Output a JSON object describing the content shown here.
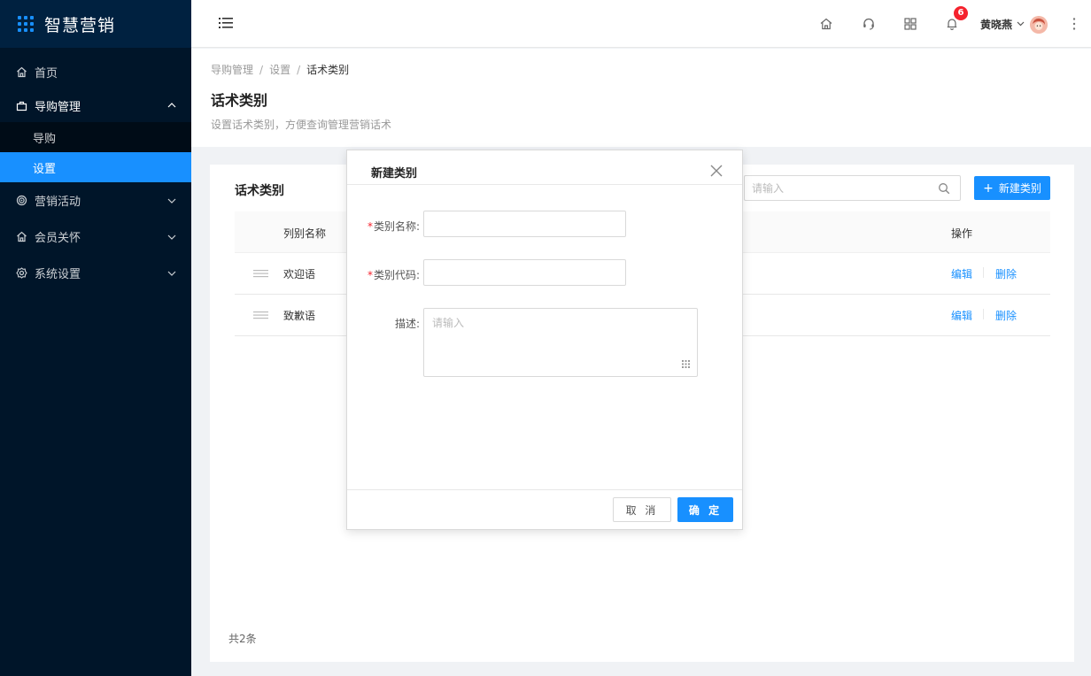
{
  "app": {
    "title": "智慧营销"
  },
  "sidebar": {
    "items": [
      {
        "label": "首页",
        "icon": "home-icon"
      },
      {
        "label": "导购管理",
        "icon": "bag-icon",
        "open": true,
        "children": [
          {
            "label": "导购"
          },
          {
            "label": "设置",
            "active": true
          }
        ]
      },
      {
        "label": "营销活动",
        "icon": "target-icon"
      },
      {
        "label": "会员关怀",
        "icon": "home-icon"
      },
      {
        "label": "系统设置",
        "icon": "gear-icon"
      }
    ]
  },
  "header": {
    "notification_count": "6",
    "user_name": "黄晓燕"
  },
  "page": {
    "breadcrumb": [
      "导购管理",
      "设置",
      "话术类别"
    ],
    "separator": "/",
    "title": "话术类别",
    "description": "设置话术类别，方便查询管理营销话术"
  },
  "card": {
    "title": "话术类别",
    "search_placeholder": "请输入",
    "new_button": "新建类别",
    "plus": "+",
    "columns": {
      "name": "列别名称",
      "action": "操作"
    },
    "rows": [
      {
        "name": "欢迎语",
        "edit": "编辑",
        "delete": "删除"
      },
      {
        "name": "致歉语",
        "edit": "编辑",
        "delete": "删除"
      }
    ],
    "total": "共2条"
  },
  "modal": {
    "title": "新建类别",
    "required_mark": "*",
    "fields": {
      "name_label": "类别名称:",
      "code_label": "类别代码:",
      "desc_label": "描述:",
      "desc_placeholder": "请输入"
    },
    "cancel": "取 消",
    "ok": "确 定"
  },
  "colors": {
    "primary": "#1890ff",
    "sidebar": "#001529",
    "danger": "#f5222d"
  }
}
